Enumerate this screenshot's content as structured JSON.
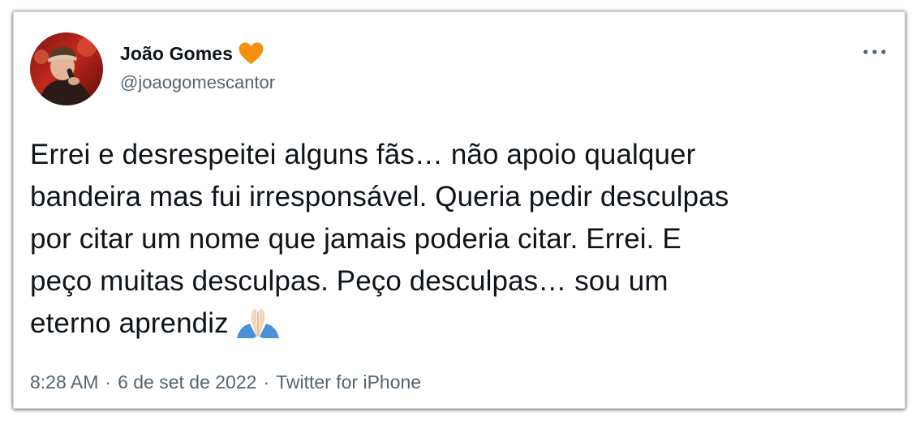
{
  "tweet": {
    "author": {
      "display_name": "João Gomes",
      "handle": "@joaogomescantor",
      "verified_badge_icon": "orange-heart-icon",
      "badge_color": "#f4900c"
    },
    "text": "Errei e desrespeitei alguns fãs… não apoio qualquer\nbandeira mas fui irresponsável. Queria pedir desculpas\npor citar um nome que jamais poderia citar. Errei. E\npeço muitas desculpas. Peço desculpas… sou um\neterno aprendiz",
    "emoji": "folded-hands-emoji",
    "time": "8:28 AM",
    "date": "6 de set de 2022",
    "separator": "·",
    "source": "Twitter for iPhone"
  },
  "menu": {
    "icon": "more-dots-icon"
  },
  "colors": {
    "text_primary": "#0f1419",
    "text_secondary": "#536471",
    "border": "#cfd9de"
  }
}
